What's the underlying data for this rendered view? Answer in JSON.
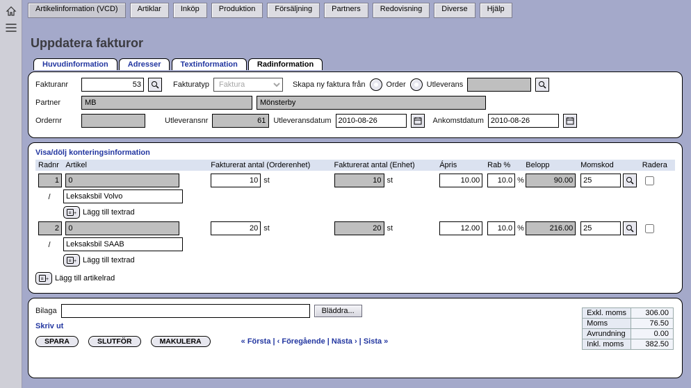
{
  "menubar": {
    "items": [
      "Artikelinformation (VCD)",
      "Artiklar",
      "Inköp",
      "Produktion",
      "Försäljning",
      "Partners",
      "Redovisning",
      "Diverse",
      "Hjälp"
    ]
  },
  "page": {
    "title": "Uppdatera fakturor"
  },
  "tabs": {
    "items": [
      "Huvudinformation",
      "Adresser",
      "Textinformation",
      "Radinformation"
    ],
    "active_index": 3
  },
  "header": {
    "fakturanr_label": "Fakturanr",
    "fakturanr_value": "53",
    "fakturatyp_label": "Fakturatyp",
    "fakturatyp_value": "Faktura",
    "skapa_label": "Skapa ny faktura från",
    "option_order": "Order",
    "option_utleverans": "Utleverans",
    "partner_label": "Partner",
    "partner_code": "MB",
    "partner_name": "Mönsterby",
    "ordernr_label": "Ordernr",
    "ordernr_value": "",
    "utleveransnr_label": "Utleveransnr",
    "utleveransnr_value": "61",
    "utleveransdatum_label": "Utleveransdatum",
    "utleveransdatum_value": "2010-08-26",
    "ankomstdatum_label": "Ankomstdatum",
    "ankomstdatum_value": "2010-08-26"
  },
  "lines": {
    "toggle_label": "Visa/dölj konteringsinformation",
    "cols": {
      "radnr": "Radnr",
      "artikel": "Artikel",
      "fao": "Fakturerat antal (Orderenhet)",
      "fae": "Fakturerat antal (Enhet)",
      "apris": "Ápris",
      "rab": "Rab %",
      "belopp": "Belopp",
      "momskod": "Momskod",
      "radera": "Radera"
    },
    "unit_suffix": "st",
    "pct_suffix": "%",
    "add_text_row": "Lägg till textrad",
    "add_article_row": "Lägg till artikelrad",
    "rows": [
      {
        "radnr": "1",
        "artikel_code": "0",
        "artikel_name": "Leksaksbil Volvo",
        "fao": "10",
        "fae": "10",
        "apris": "10.00",
        "rab": "10.0",
        "belopp": "90.00",
        "momskod": "25"
      },
      {
        "radnr": "2",
        "artikel_code": "0",
        "artikel_name": "Leksaksbil SAAB",
        "fao": "20",
        "fae": "20",
        "apris": "12.00",
        "rab": "10.0",
        "belopp": "216.00",
        "momskod": "25"
      }
    ]
  },
  "footer": {
    "bilaga_label": "Bilaga",
    "browse_label": "Bläddra...",
    "skriv_ut": "Skriv ut",
    "spara": "SPARA",
    "slutfor": "SLUTFÖR",
    "makulera": "MAKULERA",
    "pager": {
      "first": "« Första",
      "prev": "‹ Föregående",
      "next": "Nästa ›",
      "last": "Sista »",
      "sep": "|"
    },
    "totals": {
      "exkl_label": "Exkl. moms",
      "exkl_value": "306.00",
      "moms_label": "Moms",
      "moms_value": "76.50",
      "avr_label": "Avrundning",
      "avr_value": "0.00",
      "inkl_label": "Inkl. moms",
      "inkl_value": "382.50"
    }
  }
}
